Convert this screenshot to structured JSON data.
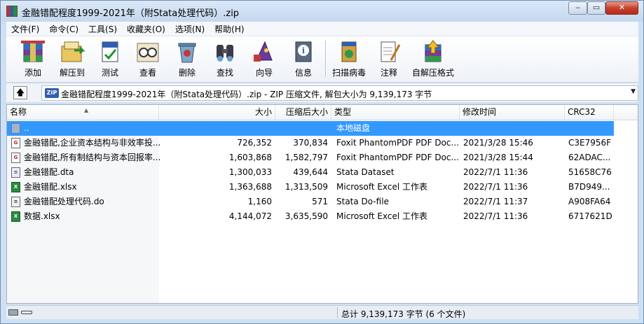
{
  "window": {
    "title": "金融错配程度1999-2021年（附Stata处理代码）.zip"
  },
  "menu": [
    {
      "label": "文件(F)"
    },
    {
      "label": "命令(C)"
    },
    {
      "label": "工具(S)"
    },
    {
      "label": "收藏夹(O)"
    },
    {
      "label": "选项(N)"
    },
    {
      "label": "帮助(H)"
    }
  ],
  "toolbar": [
    {
      "label": "添加",
      "icon": "add-archive-icon"
    },
    {
      "label": "解压到",
      "icon": "extract-to-icon"
    },
    {
      "label": "测试",
      "icon": "test-icon"
    },
    {
      "label": "查看",
      "icon": "view-icon"
    },
    {
      "label": "删除",
      "icon": "delete-icon"
    },
    {
      "label": "查找",
      "icon": "find-icon"
    },
    {
      "label": "向导",
      "icon": "wizard-icon"
    },
    {
      "label": "信息",
      "icon": "info-icon"
    },
    {
      "label": "扫描病毒",
      "icon": "virus-scan-icon"
    },
    {
      "label": "注释",
      "icon": "comment-icon"
    },
    {
      "label": "自解压格式",
      "icon": "sfx-icon"
    }
  ],
  "address": {
    "icon_label": "ZIP",
    "path": "金融错配程度1999-2021年（附Stata处理代码）.zip - ZIP 压缩文件, 解包大小为 9,139,173 字节"
  },
  "columns": {
    "name": "名称",
    "size": "大小",
    "packed": "压缩后大小",
    "type": "类型",
    "modified": "修改时间",
    "crc": "CRC32"
  },
  "files": [
    {
      "name": "..",
      "size": "",
      "packed": "",
      "type": "本地磁盘",
      "modified": "",
      "crc": "",
      "icon": "up",
      "icon_text": ""
    },
    {
      "name": "金融错配,企业资本结构与非效率投...",
      "size": "726,352",
      "packed": "370,834",
      "type": "Foxit PhantomPDF PDF Doc...",
      "modified": "2021/3/28 15:46",
      "crc": "C3E7956F",
      "icon": "pdf",
      "icon_text": "G"
    },
    {
      "name": "金融错配,所有制结构与资本回报率...",
      "size": "1,603,868",
      "packed": "1,582,797",
      "type": "Foxit PhantomPDF PDF Doc...",
      "modified": "2021/3/28 15:44",
      "crc": "62ADAC...",
      "icon": "pdf",
      "icon_text": "G"
    },
    {
      "name": "金融错配.dta",
      "size": "1,300,033",
      "packed": "439,644",
      "type": "Stata Dataset",
      "modified": "2022/7/1 11:36",
      "crc": "51658C76",
      "icon": "dta",
      "icon_text": "≡"
    },
    {
      "name": "金融错配.xlsx",
      "size": "1,363,688",
      "packed": "1,313,509",
      "type": "Microsoft Excel 工作表",
      "modified": "2022/7/1 11:36",
      "crc": "B7D949...",
      "icon": "xls",
      "icon_text": "X"
    },
    {
      "name": "金融错配处理代码.do",
      "size": "1,160",
      "packed": "571",
      "type": "Stata Do-file",
      "modified": "2022/7/1 11:37",
      "crc": "A908FA64",
      "icon": "do",
      "icon_text": "≡"
    },
    {
      "name": "数据.xlsx",
      "size": "4,144,072",
      "packed": "3,635,590",
      "type": "Microsoft Excel 工作表",
      "modified": "2022/7/1 11:36",
      "crc": "6717621D",
      "icon": "xls",
      "icon_text": "X"
    }
  ],
  "status": {
    "text": "总计 9,139,173 字节 (6 个文件)"
  }
}
